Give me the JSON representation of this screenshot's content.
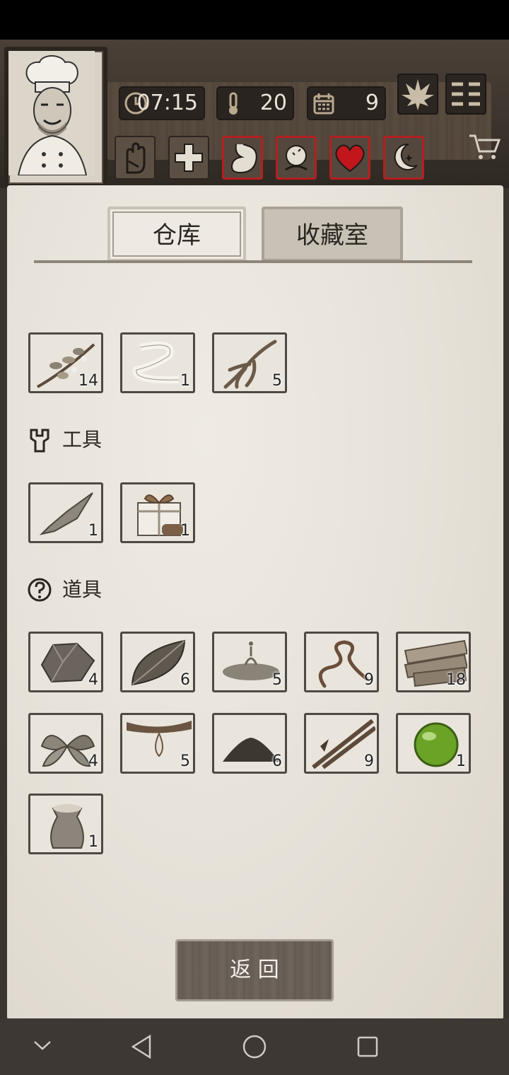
{
  "hud": {
    "time": "07:15",
    "temperature": "20",
    "day": "9",
    "clock_icon": "clock-icon",
    "thermometer_icon": "thermometer-icon",
    "calendar_icon": "calendar-icon",
    "leaf_button_icon": "leaf-icon",
    "menu_button_icon": "menu-icon",
    "conditions": [
      {
        "name": "hand-icon",
        "alert": false
      },
      {
        "name": "medical-cross-icon",
        "alert": false
      },
      {
        "name": "stomach-icon",
        "alert": true
      },
      {
        "name": "head-icon",
        "alert": true
      },
      {
        "name": "heart-icon",
        "alert": true
      },
      {
        "name": "moon-icon",
        "alert": true
      }
    ],
    "alert_color": "#b51f1f"
  },
  "tabs": {
    "warehouse": "仓库",
    "collection": "收藏室"
  },
  "sections": {
    "tools": "工具",
    "props": "道具"
  },
  "items_top": [
    {
      "icon": "herb-branch-icon",
      "qty": "14"
    },
    {
      "icon": "cloth-strip-icon",
      "qty": "1"
    },
    {
      "icon": "ginseng-root-icon",
      "qty": "5"
    }
  ],
  "items_tools": [
    {
      "icon": "stone-blade-icon",
      "qty": "1"
    },
    {
      "icon": "gift-box-icon",
      "qty": "1"
    }
  ],
  "items_props": [
    {
      "icon": "rock-icon",
      "qty": "4"
    },
    {
      "icon": "leaf-icon",
      "qty": "6"
    },
    {
      "icon": "water-splash-icon",
      "qty": "5"
    },
    {
      "icon": "vine-icon",
      "qty": "9"
    },
    {
      "icon": "wood-planks-icon",
      "qty": "18"
    },
    {
      "icon": "mint-leaves-icon",
      "qty": "4"
    },
    {
      "icon": "resin-drop-icon",
      "qty": "5"
    },
    {
      "icon": "soil-pile-icon",
      "qty": "6"
    },
    {
      "icon": "bamboo-arrow-icon",
      "qty": "9"
    },
    {
      "icon": "green-orb-icon",
      "qty": "1"
    },
    {
      "icon": "grain-sack-icon",
      "qty": "1"
    }
  ],
  "back_button": "返 回"
}
